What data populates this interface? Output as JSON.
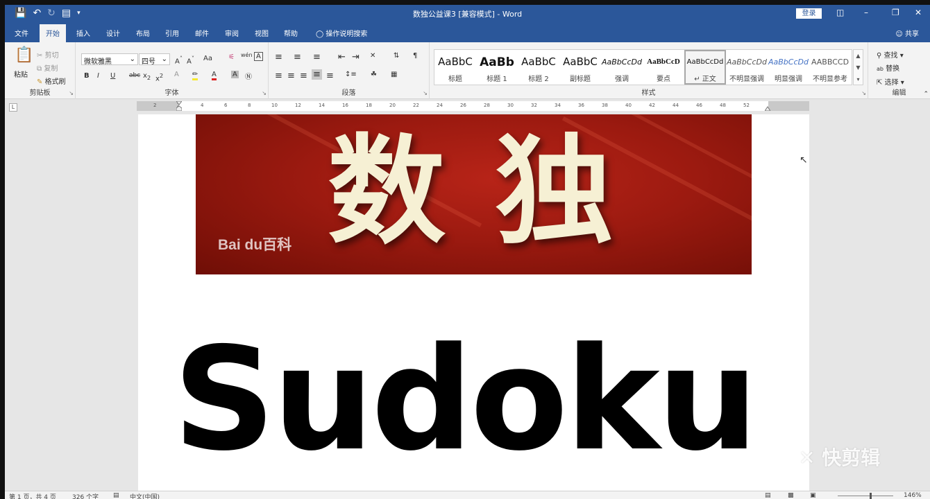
{
  "titlebar": {
    "title": "数独公益课3 [兼容模式] - Word",
    "login": "登录",
    "qat": {
      "save_icon": "save-icon",
      "undo_icon": "undo-icon",
      "redo_icon": "redo-icon",
      "preview_icon": "print-preview-icon",
      "customize_icon": "chevron-down-icon"
    },
    "window_buttons": [
      "ribbon-display-icon",
      "minimize-icon",
      "restore-icon",
      "close-icon"
    ]
  },
  "tabs": [
    "文件",
    "开始",
    "插入",
    "设计",
    "布局",
    "引用",
    "邮件",
    "审阅",
    "视图",
    "帮助"
  ],
  "active_tab": "开始",
  "tell_me": "操作说明搜索",
  "share": "共享",
  "ribbon": {
    "clipboard": {
      "label": "剪贴板",
      "paste": "粘贴",
      "cut": "剪切",
      "copy": "复制",
      "format_painter": "格式刷"
    },
    "font": {
      "label": "字体",
      "font_name": "微软雅黑",
      "font_size": "四号",
      "change_case": "Aa",
      "phonetic": "wén"
    },
    "paragraph": {
      "label": "段落"
    },
    "styles": {
      "label": "样式",
      "items": [
        {
          "sample": "AaBbC",
          "name": "标题"
        },
        {
          "sample": "AaBb",
          "name": "标题 1"
        },
        {
          "sample": "AaBbC",
          "name": "标题 2"
        },
        {
          "sample": "AaBbC",
          "name": "副标题"
        },
        {
          "sample": "AaBbCcDd",
          "name": "强调"
        },
        {
          "sample": "AaBbCcD",
          "name": "要点"
        },
        {
          "sample": "AaBbCcDd",
          "name": "↵ 正文"
        },
        {
          "sample": "AaBbCcDd",
          "name": "不明显强调"
        },
        {
          "sample": "AaBbCcDd",
          "name": "明显强调"
        },
        {
          "sample": "AABBCCD",
          "name": "不明显参考"
        }
      ],
      "selected_index": 6
    },
    "editing": {
      "label": "编辑",
      "find": "查找",
      "replace": "替换",
      "select": "选择"
    }
  },
  "ruler": {
    "corner": "L",
    "ticks": [
      "2",
      "2",
      "4",
      "6",
      "8",
      "10",
      "12",
      "14",
      "16",
      "18",
      "20",
      "22",
      "24",
      "26",
      "28",
      "30",
      "32",
      "34",
      "36",
      "38",
      "40",
      "42",
      "44",
      "46",
      "48",
      "52"
    ]
  },
  "document": {
    "banner_text": "数 独",
    "banner_logo": "Bai du百科",
    "heading": "Sudoku"
  },
  "watermark": "快剪辑",
  "status": {
    "page": "第 1 页，共 4 页",
    "words": "326 个字",
    "language": "中文(中国)",
    "zoom": "146%"
  }
}
